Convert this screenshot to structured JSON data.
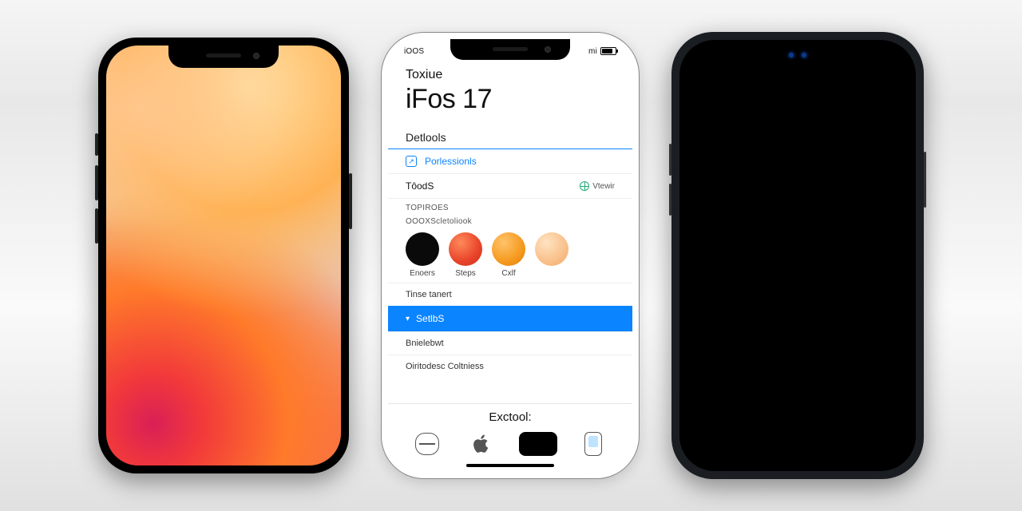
{
  "statusbar": {
    "left": "iOOS",
    "right_text": "mi"
  },
  "header": {
    "eyebrow": "Toxiue",
    "title": "iFos 17"
  },
  "section1": {
    "heading": "Detlools",
    "link_label": "Porlessionls",
    "row2_label": "TôodS",
    "row2_trail": "Vtewir"
  },
  "section2": {
    "heading": "TOPIROES",
    "subheading": "OOOXScletoliook"
  },
  "swatches": {
    "labels": [
      "Enoers",
      "Steps",
      "Cxlf",
      ""
    ],
    "colors": {
      "black": "#0a0a0a",
      "red": "#e8432a",
      "orange": "#f59a1f",
      "peach": "#f9c08a"
    }
  },
  "list": {
    "item1": "Tinse tanert",
    "highlight": "SetlbS",
    "item3": "Bnielebwt",
    "item4": "Oiritodesc Coltniess"
  },
  "footer": {
    "label": "Exctool:"
  }
}
